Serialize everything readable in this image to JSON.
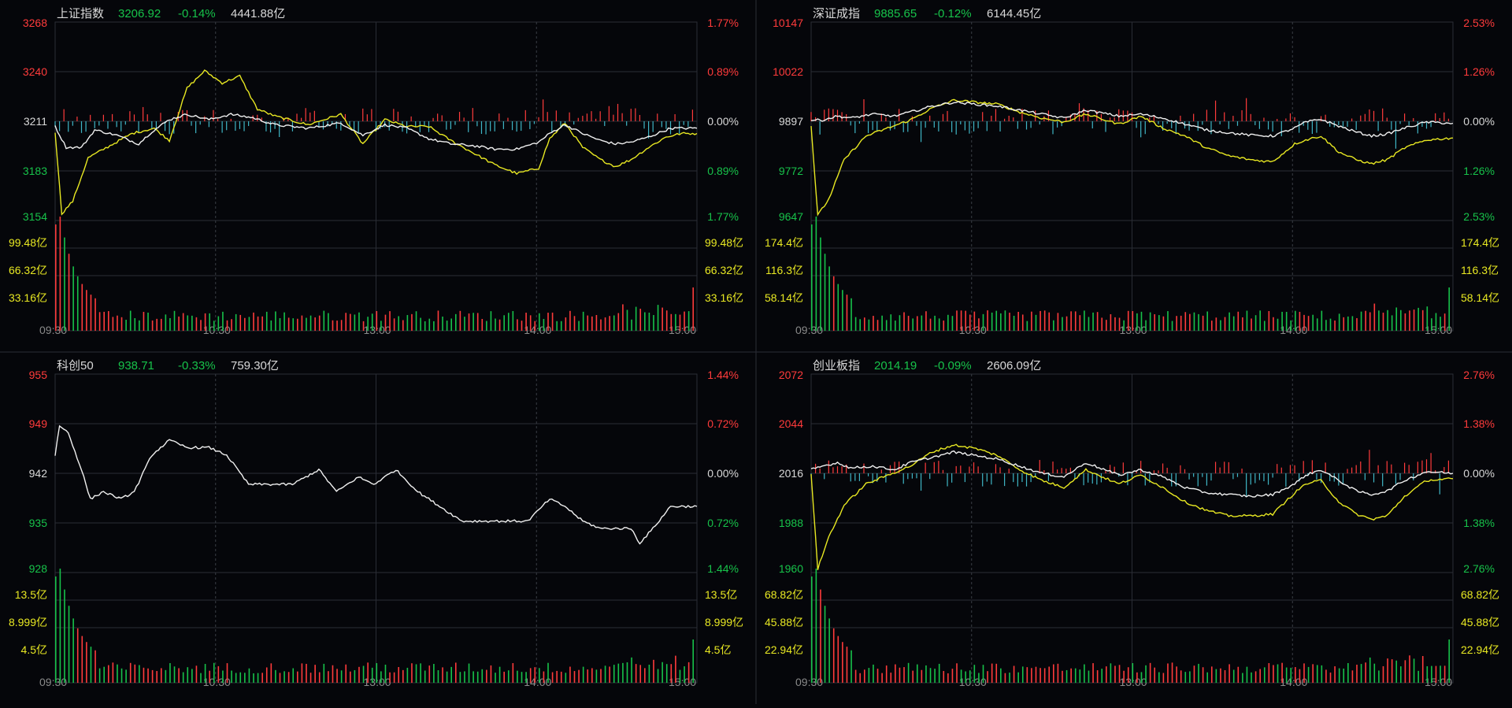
{
  "colors": {
    "background": "#05060a",
    "grid": "#2a2d35",
    "grid_dash": "#3a3d45",
    "up": "#ff3b3b",
    "down": "#17c24a",
    "neutral": "#d8d8d8",
    "yellow": "#e8e822",
    "white": "#f0f0f0",
    "cyan": "#3fb6c6",
    "time": "#8a8a8a"
  },
  "time_labels": [
    "09:30",
    "10:30",
    "13:00",
    "14:00",
    "15:00"
  ],
  "chart_data": [
    {
      "type": "line",
      "name": "上证指数",
      "last": "3206.92",
      "change": "-0.14%",
      "turnover": "4441.88亿",
      "prev_close": 3211,
      "price_ticks": [
        "3268",
        "3240",
        "3211",
        "3183",
        "3154"
      ],
      "pct_ticks": [
        "1.77%",
        "0.89%",
        "0.00%",
        "0.89%",
        "1.77%"
      ],
      "vol_ticks": [
        "99.48亿",
        "66.32亿",
        "33.16亿"
      ],
      "series": [
        {
          "color": "yellow",
          "key": [
            [
              0,
              3205
            ],
            [
              3,
              3158
            ],
            [
              8,
              3165
            ],
            [
              15,
              3190
            ],
            [
              25,
              3197
            ],
            [
              35,
              3204
            ],
            [
              45,
              3207
            ],
            [
              52,
              3200
            ],
            [
              60,
              3230
            ],
            [
              68,
              3240
            ],
            [
              76,
              3233
            ],
            [
              84,
              3237
            ],
            [
              92,
              3218
            ],
            [
              100,
              3214
            ],
            [
              115,
              3209
            ],
            [
              130,
              3215
            ],
            [
              140,
              3198
            ],
            [
              150,
              3212
            ],
            [
              160,
              3208
            ],
            [
              170,
              3208
            ],
            [
              180,
              3200
            ],
            [
              190,
              3193
            ],
            [
              200,
              3186
            ],
            [
              210,
              3181
            ],
            [
              220,
              3184
            ],
            [
              225,
              3201
            ],
            [
              232,
              3210
            ],
            [
              240,
              3196
            ],
            [
              248,
              3189
            ],
            [
              255,
              3185
            ],
            [
              262,
              3189
            ],
            [
              270,
              3196
            ],
            [
              278,
              3202
            ],
            [
              285,
              3204
            ],
            [
              292,
              3204
            ]
          ]
        },
        {
          "color": "white",
          "key": [
            [
              0,
              3208
            ],
            [
              5,
              3196
            ],
            [
              12,
              3196
            ],
            [
              18,
              3206
            ],
            [
              28,
              3203
            ],
            [
              38,
              3198
            ],
            [
              44,
              3205
            ],
            [
              52,
              3212
            ],
            [
              60,
              3215
            ],
            [
              70,
              3212
            ],
            [
              80,
              3215
            ],
            [
              90,
              3213
            ],
            [
              100,
              3209
            ],
            [
              115,
              3207
            ],
            [
              130,
              3210
            ],
            [
              140,
              3203
            ],
            [
              150,
              3209
            ],
            [
              160,
              3207
            ],
            [
              170,
              3201
            ],
            [
              180,
              3198
            ],
            [
              190,
              3197
            ],
            [
              200,
              3195
            ],
            [
              210,
              3195
            ],
            [
              220,
              3199
            ],
            [
              225,
              3204
            ],
            [
              232,
              3209
            ],
            [
              240,
              3204
            ],
            [
              248,
              3200
            ],
            [
              255,
              3198
            ],
            [
              262,
              3199
            ],
            [
              270,
              3202
            ],
            [
              280,
              3207
            ],
            [
              292,
              3207
            ]
          ]
        }
      ],
      "x_total": 240
    },
    {
      "type": "line",
      "name": "深证成指",
      "last": "9885.65",
      "change": "-0.12%",
      "turnover": "6144.45亿",
      "prev_close": 9897,
      "price_ticks": [
        "10147",
        "10022",
        "9897",
        "9772",
        "9647"
      ],
      "pct_ticks": [
        "2.53%",
        "1.26%",
        "0.00%",
        "1.26%",
        "2.53%"
      ],
      "vol_ticks": [
        "174.4亿",
        "116.3亿",
        "58.14亿"
      ],
      "series": [
        {
          "color": "yellow",
          "key": [
            [
              0,
              9885
            ],
            [
              3,
              9660
            ],
            [
              8,
              9700
            ],
            [
              15,
              9800
            ],
            [
              25,
              9860
            ],
            [
              35,
              9880
            ],
            [
              45,
              9900
            ],
            [
              55,
              9930
            ],
            [
              65,
              9950
            ],
            [
              75,
              9945
            ],
            [
              85,
              9940
            ],
            [
              95,
              9920
            ],
            [
              105,
              9905
            ],
            [
              115,
              9895
            ],
            [
              125,
              9915
            ],
            [
              140,
              9890
            ],
            [
              150,
              9910
            ],
            [
              160,
              9880
            ],
            [
              170,
              9860
            ],
            [
              180,
              9830
            ],
            [
              190,
              9810
            ],
            [
              200,
              9800
            ],
            [
              210,
              9795
            ],
            [
              220,
              9840
            ],
            [
              225,
              9850
            ],
            [
              232,
              9860
            ],
            [
              240,
              9820
            ],
            [
              248,
              9800
            ],
            [
              255,
              9790
            ],
            [
              262,
              9800
            ],
            [
              270,
              9830
            ],
            [
              280,
              9850
            ],
            [
              292,
              9855
            ]
          ]
        },
        {
          "color": "white",
          "key": [
            [
              0,
              9900
            ],
            [
              5,
              9900
            ],
            [
              12,
              9910
            ],
            [
              18,
              9905
            ],
            [
              28,
              9915
            ],
            [
              38,
              9910
            ],
            [
              45,
              9920
            ],
            [
              55,
              9935
            ],
            [
              65,
              9945
            ],
            [
              75,
              9940
            ],
            [
              85,
              9935
            ],
            [
              95,
              9925
            ],
            [
              105,
              9915
            ],
            [
              115,
              9905
            ],
            [
              125,
              9925
            ],
            [
              140,
              9910
            ],
            [
              150,
              9915
            ],
            [
              160,
              9905
            ],
            [
              170,
              9890
            ],
            [
              180,
              9875
            ],
            [
              190,
              9868
            ],
            [
              200,
              9862
            ],
            [
              210,
              9860
            ],
            [
              220,
              9880
            ],
            [
              225,
              9895
            ],
            [
              232,
              9902
            ],
            [
              240,
              9885
            ],
            [
              248,
              9870
            ],
            [
              255,
              9860
            ],
            [
              262,
              9865
            ],
            [
              270,
              9880
            ],
            [
              280,
              9895
            ],
            [
              292,
              9892
            ]
          ]
        }
      ],
      "x_total": 240
    },
    {
      "type": "line",
      "name": "科创50",
      "last": "938.71",
      "change": "-0.33%",
      "turnover": "759.30亿",
      "prev_close": 942,
      "price_ticks": [
        "955",
        "949",
        "942",
        "935",
        "928"
      ],
      "pct_ticks": [
        "1.44%",
        "0.72%",
        "0.00%",
        "0.72%",
        "1.44%"
      ],
      "vol_ticks": [
        "13.5亿",
        "8.999亿",
        "4.5亿"
      ],
      "series": [
        {
          "color": "white",
          "key": [
            [
              0,
              944
            ],
            [
              2,
              948
            ],
            [
              6,
              947
            ],
            [
              12,
              942
            ],
            [
              16,
              938
            ],
            [
              22,
              939
            ],
            [
              30,
              938
            ],
            [
              36,
              939
            ],
            [
              44,
              944
            ],
            [
              52,
              946
            ],
            [
              60,
              945
            ],
            [
              70,
              945
            ],
            [
              78,
              944
            ],
            [
              88,
              940
            ],
            [
              98,
              940
            ],
            [
              108,
              940
            ],
            [
              120,
              942
            ],
            [
              128,
              939
            ],
            [
              138,
              941
            ],
            [
              145,
              940
            ],
            [
              155,
              942
            ],
            [
              165,
              939
            ],
            [
              175,
              937
            ],
            [
              185,
              935
            ],
            [
              195,
              935
            ],
            [
              205,
              935
            ],
            [
              215,
              935
            ],
            [
              225,
              938
            ],
            [
              232,
              937
            ],
            [
              240,
              935
            ],
            [
              248,
              934
            ],
            [
              255,
              934
            ],
            [
              262,
              934
            ],
            [
              266,
              932
            ],
            [
              272,
              934
            ],
            [
              280,
              937
            ],
            [
              292,
              937
            ]
          ]
        }
      ],
      "x_total": 240
    },
    {
      "type": "line",
      "name": "创业板指",
      "last": "2014.19",
      "change": "-0.09%",
      "turnover": "2606.09亿",
      "prev_close": 2016,
      "price_ticks": [
        "2072",
        "2044",
        "2016",
        "1988",
        "1960"
      ],
      "pct_ticks": [
        "2.76%",
        "1.38%",
        "0.00%",
        "1.38%",
        "2.76%"
      ],
      "vol_ticks": [
        "68.82亿",
        "45.88亿",
        "22.94亿"
      ],
      "series": [
        {
          "color": "yellow",
          "key": [
            [
              0,
              2016
            ],
            [
              3,
              1962
            ],
            [
              8,
              1980
            ],
            [
              15,
              1998
            ],
            [
              25,
              2010
            ],
            [
              35,
              2015
            ],
            [
              45,
              2020
            ],
            [
              55,
              2028
            ],
            [
              65,
              2032
            ],
            [
              75,
              2030
            ],
            [
              85,
              2026
            ],
            [
              95,
              2018
            ],
            [
              105,
              2012
            ],
            [
              115,
              2008
            ],
            [
              125,
              2018
            ],
            [
              140,
              2010
            ],
            [
              150,
              2015
            ],
            [
              160,
              2008
            ],
            [
              170,
              2000
            ],
            [
              180,
              1995
            ],
            [
              190,
              1992
            ],
            [
              200,
              1992
            ],
            [
              210,
              1993
            ],
            [
              220,
              2005
            ],
            [
              225,
              2010
            ],
            [
              232,
              2012
            ],
            [
              240,
              2000
            ],
            [
              248,
              1993
            ],
            [
              255,
              1990
            ],
            [
              262,
              1992
            ],
            [
              270,
              2003
            ],
            [
              280,
              2012
            ],
            [
              292,
              2013
            ]
          ]
        },
        {
          "color": "white",
          "key": [
            [
              0,
              2018
            ],
            [
              5,
              2020
            ],
            [
              12,
              2022
            ],
            [
              18,
              2019
            ],
            [
              28,
              2020
            ],
            [
              38,
              2018
            ],
            [
              45,
              2022
            ],
            [
              55,
              2025
            ],
            [
              65,
              2028
            ],
            [
              75,
              2026
            ],
            [
              85,
              2024
            ],
            [
              95,
              2020
            ],
            [
              105,
              2016
            ],
            [
              115,
              2014
            ],
            [
              125,
              2022
            ],
            [
              140,
              2015
            ],
            [
              150,
              2018
            ],
            [
              160,
              2014
            ],
            [
              170,
              2008
            ],
            [
              180,
              2005
            ],
            [
              190,
              2004
            ],
            [
              200,
              2003
            ],
            [
              210,
              2004
            ],
            [
              220,
              2010
            ],
            [
              225,
              2015
            ],
            [
              232,
              2018
            ],
            [
              240,
              2012
            ],
            [
              248,
              2006
            ],
            [
              255,
              2004
            ],
            [
              262,
              2006
            ],
            [
              270,
              2012
            ],
            [
              280,
              2017
            ],
            [
              292,
              2016
            ]
          ]
        }
      ],
      "x_total": 240
    }
  ]
}
